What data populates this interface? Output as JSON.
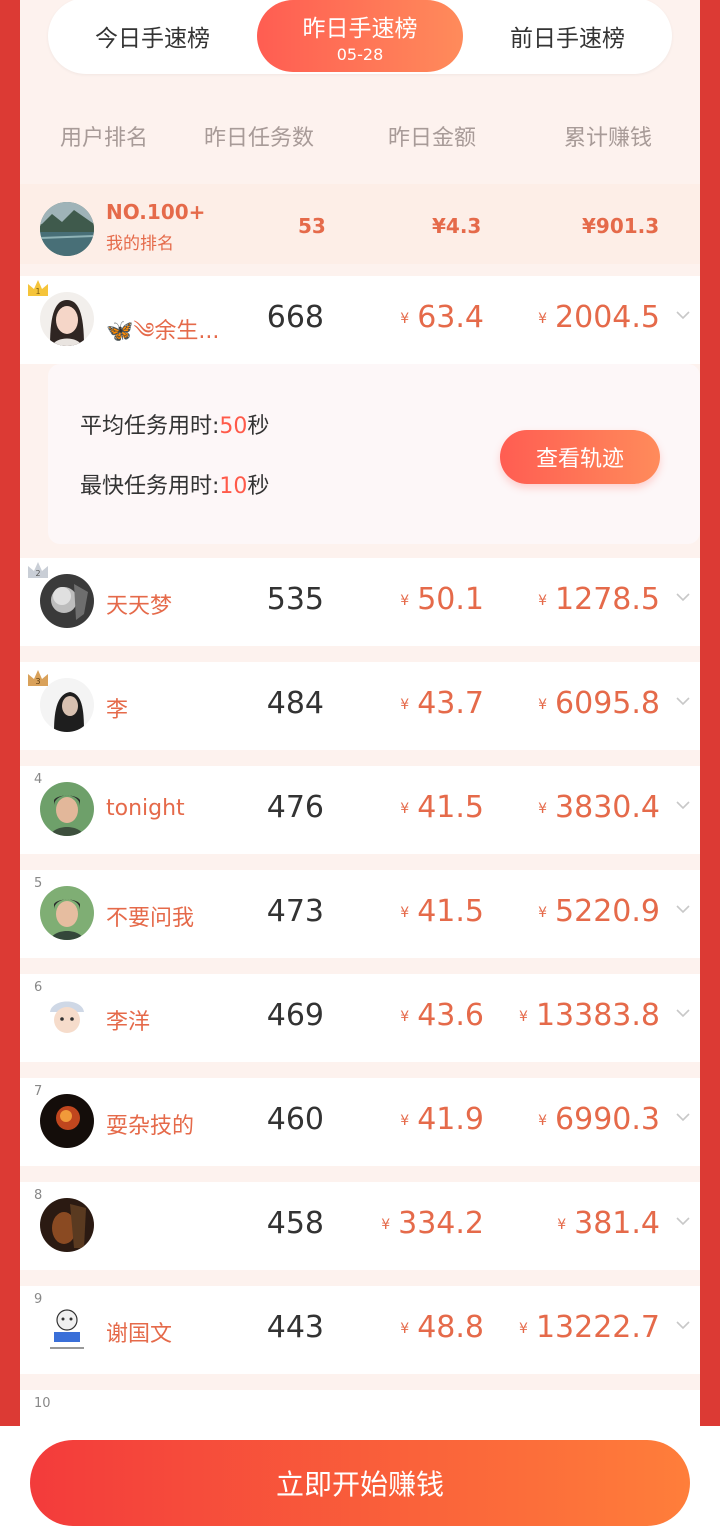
{
  "tabs": [
    {
      "label": "今日手速榜",
      "date": ""
    },
    {
      "label": "昨日手速榜",
      "date": "05-28"
    },
    {
      "label": "前日手速榜",
      "date": ""
    }
  ],
  "columns": [
    "用户排名",
    "昨日任务数",
    "昨日金额",
    "累计赚钱"
  ],
  "my_row": {
    "rank": "NO.100+",
    "label": "我的排名",
    "tasks": "53",
    "amount": "¥4.3",
    "total": "¥901.3"
  },
  "currency": "¥",
  "detail": {
    "avg_label": "平均任务用时:",
    "avg_value": "50",
    "fast_label": "最快任务用时:",
    "fast_value": "10",
    "unit": "秒",
    "button": "查看轨迹"
  },
  "rows": [
    {
      "rank": "1",
      "name": "🦋༄余生...",
      "tasks": "668",
      "amount": "63.4",
      "total": "2004.5"
    },
    {
      "rank": "2",
      "name": "天天梦",
      "tasks": "535",
      "amount": "50.1",
      "total": "1278.5"
    },
    {
      "rank": "3",
      "name": "李",
      "tasks": "484",
      "amount": "43.7",
      "total": "6095.8"
    },
    {
      "rank": "4",
      "name": "tonight",
      "tasks": "476",
      "amount": "41.5",
      "total": "3830.4"
    },
    {
      "rank": "5",
      "name": "不要问我",
      "tasks": "473",
      "amount": "41.5",
      "total": "5220.9"
    },
    {
      "rank": "6",
      "name": "李洋",
      "tasks": "469",
      "amount": "43.6",
      "total": "13383.8"
    },
    {
      "rank": "7",
      "name": "耍杂技的",
      "tasks": "460",
      "amount": "41.9",
      "total": "6990.3"
    },
    {
      "rank": "8",
      "name": "",
      "tasks": "458",
      "amount": "334.2",
      "total": "381.4"
    },
    {
      "rank": "9",
      "name": "谢国文",
      "tasks": "443",
      "amount": "48.8",
      "total": "13222.7"
    },
    {
      "rank": "10",
      "name": "",
      "tasks": "",
      "amount": "",
      "total": ""
    }
  ],
  "cta_label": "立即开始赚钱",
  "colors": {
    "accent": "#ff5d52",
    "accent2": "#ff8b5b",
    "text_red": "#e56a4a",
    "gold": "#f5c43a",
    "silver": "#c9ced6",
    "bronze": "#d9a15a"
  }
}
